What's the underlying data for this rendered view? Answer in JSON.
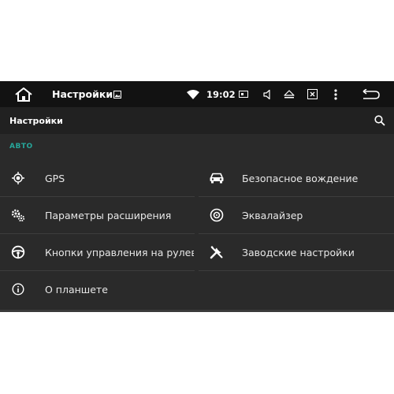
{
  "status_bar": {
    "title": "Настройки",
    "time": "19:02",
    "icons": [
      "home-icon",
      "image-icon",
      "wifi-icon",
      "screenshot-icon",
      "volume-icon",
      "eject-icon",
      "close-box-icon",
      "more-vert-icon",
      "back-icon"
    ]
  },
  "app_bar": {
    "title": "Настройки",
    "search_icon": "search-icon"
  },
  "section": {
    "header": "АВТО"
  },
  "tiles": [
    {
      "label": "GPS",
      "icon": "gps-icon"
    },
    {
      "label": "Безопасное вождение",
      "icon": "car-icon"
    },
    {
      "label": "Параметры расширения",
      "icon": "gears-icon"
    },
    {
      "label": "Эквалайзер",
      "icon": "speaker-icon"
    },
    {
      "label": "Кнопки управления на рулевом колесе",
      "icon": "steering-wheel-icon"
    },
    {
      "label": "Заводские настройки",
      "icon": "tools-icon"
    },
    {
      "label": "О планшете",
      "icon": "info-icon"
    }
  ],
  "colors": {
    "accent": "#26a69a",
    "background": "#2a2a2a",
    "status_bar": "#121212",
    "app_bar": "#212121"
  }
}
